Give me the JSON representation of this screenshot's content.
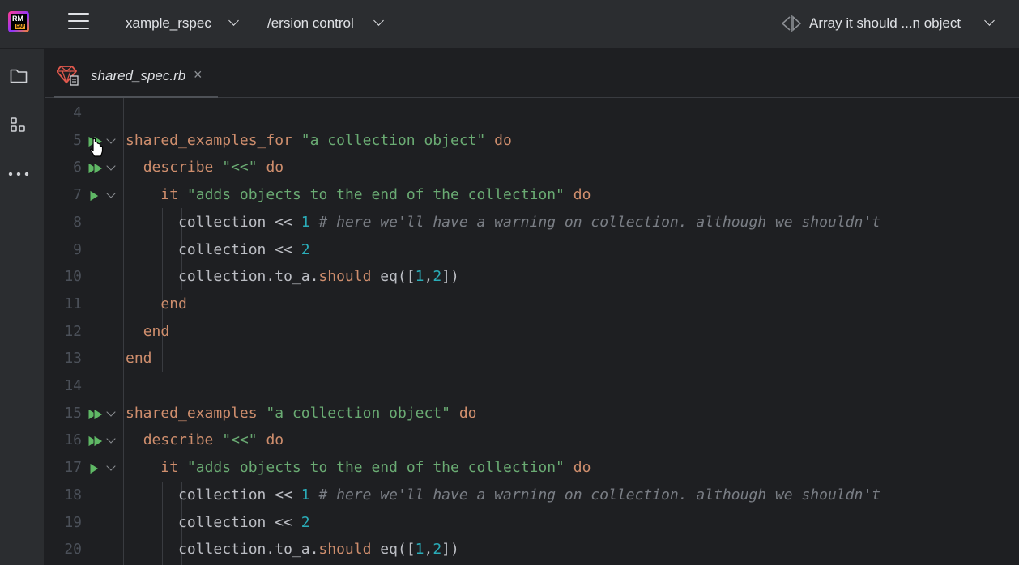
{
  "titlebar": {
    "app_logo_text": "RM",
    "app_badge_text": "EAP",
    "project_name": "xample_rspec",
    "vcs_label": "/ersion control",
    "run_config": "Array it should ...n object"
  },
  "tab": {
    "filename": "shared_spec.rb",
    "close": "×"
  },
  "colors": {
    "keyword": "#cf8e6d",
    "string": "#6aab73",
    "number": "#2aacb8",
    "comment": "#7a7e85",
    "run_icon": "#5fb865",
    "background": "#1e1f22"
  },
  "lines": [
    {
      "n": "4"
    },
    {
      "n": "5",
      "gutter": "run-all",
      "fold": true,
      "tokens": [
        {
          "k": "kw",
          "t": "shared_examples_for"
        },
        {
          "k": "p",
          "t": " "
        },
        {
          "k": "str",
          "t": "\"a collection object\""
        },
        {
          "k": "p",
          "t": " "
        },
        {
          "k": "kw",
          "t": "do"
        }
      ]
    },
    {
      "n": "6",
      "gutter": "run-all",
      "fold": true,
      "tokens": [
        {
          "k": "p",
          "t": "  "
        },
        {
          "k": "kw",
          "t": "describe"
        },
        {
          "k": "p",
          "t": " "
        },
        {
          "k": "str",
          "t": "\"<<\""
        },
        {
          "k": "p",
          "t": " "
        },
        {
          "k": "kw",
          "t": "do"
        }
      ]
    },
    {
      "n": "7",
      "gutter": "run",
      "fold": true,
      "tokens": [
        {
          "k": "p",
          "t": "    "
        },
        {
          "k": "kw",
          "t": "it"
        },
        {
          "k": "p",
          "t": " "
        },
        {
          "k": "str",
          "t": "\"adds objects to the end of the collection\""
        },
        {
          "k": "p",
          "t": " "
        },
        {
          "k": "kw",
          "t": "do"
        }
      ]
    },
    {
      "n": "8",
      "tokens": [
        {
          "k": "p",
          "t": "      collection << "
        },
        {
          "k": "num",
          "t": "1"
        },
        {
          "k": "p",
          "t": " "
        },
        {
          "k": "com",
          "t": "# here we'll have a warning on collection. although we shouldn't"
        }
      ]
    },
    {
      "n": "9",
      "tokens": [
        {
          "k": "p",
          "t": "      collection << "
        },
        {
          "k": "num",
          "t": "2"
        }
      ]
    },
    {
      "n": "10",
      "tokens": [
        {
          "k": "p",
          "t": "      collection.to_a."
        },
        {
          "k": "kw",
          "t": "should"
        },
        {
          "k": "p",
          "t": " eq(["
        },
        {
          "k": "num",
          "t": "1"
        },
        {
          "k": "p",
          "t": ","
        },
        {
          "k": "num",
          "t": "2"
        },
        {
          "k": "p",
          "t": "])"
        }
      ]
    },
    {
      "n": "11",
      "tokens": [
        {
          "k": "p",
          "t": "    "
        },
        {
          "k": "kw",
          "t": "end"
        }
      ]
    },
    {
      "n": "12",
      "tokens": [
        {
          "k": "p",
          "t": "  "
        },
        {
          "k": "kw",
          "t": "end"
        }
      ]
    },
    {
      "n": "13",
      "tokens": [
        {
          "k": "kw",
          "t": "end"
        }
      ]
    },
    {
      "n": "14"
    },
    {
      "n": "15",
      "gutter": "run-all",
      "fold": true,
      "tokens": [
        {
          "k": "kw",
          "t": "shared_examples"
        },
        {
          "k": "p",
          "t": " "
        },
        {
          "k": "str",
          "t": "\"a collection object\""
        },
        {
          "k": "p",
          "t": " "
        },
        {
          "k": "kw",
          "t": "do"
        }
      ]
    },
    {
      "n": "16",
      "gutter": "run-all",
      "fold": true,
      "tokens": [
        {
          "k": "p",
          "t": "  "
        },
        {
          "k": "kw",
          "t": "describe"
        },
        {
          "k": "p",
          "t": " "
        },
        {
          "k": "str",
          "t": "\"<<\""
        },
        {
          "k": "p",
          "t": " "
        },
        {
          "k": "kw",
          "t": "do"
        }
      ]
    },
    {
      "n": "17",
      "gutter": "run",
      "fold": true,
      "tokens": [
        {
          "k": "p",
          "t": "    "
        },
        {
          "k": "kw",
          "t": "it"
        },
        {
          "k": "p",
          "t": " "
        },
        {
          "k": "str",
          "t": "\"adds objects to the end of the collection\""
        },
        {
          "k": "p",
          "t": " "
        },
        {
          "k": "kw",
          "t": "do"
        }
      ]
    },
    {
      "n": "18",
      "tokens": [
        {
          "k": "p",
          "t": "      collection << "
        },
        {
          "k": "num",
          "t": "1"
        },
        {
          "k": "p",
          "t": " "
        },
        {
          "k": "com",
          "t": "# here we'll have a warning on collection. although we shouldn't"
        }
      ]
    },
    {
      "n": "19",
      "tokens": [
        {
          "k": "p",
          "t": "      collection << "
        },
        {
          "k": "num",
          "t": "2"
        }
      ]
    },
    {
      "n": "20",
      "tokens": [
        {
          "k": "p",
          "t": "      collection.to_a."
        },
        {
          "k": "kw",
          "t": "should"
        },
        {
          "k": "p",
          "t": " eq(["
        },
        {
          "k": "num",
          "t": "1"
        },
        {
          "k": "p",
          "t": ","
        },
        {
          "k": "num",
          "t": "2"
        },
        {
          "k": "p",
          "t": "])"
        }
      ]
    }
  ]
}
